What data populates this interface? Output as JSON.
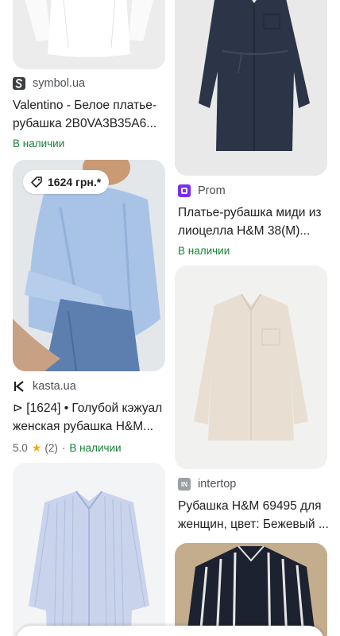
{
  "results": {
    "left": [
      {
        "source": "symbol.ua",
        "title": "Valentino - Белое платье-рубашка 2B0VA3B35A6...",
        "stock": "В наличии"
      },
      {
        "price": "1624 грн.*",
        "source": "kasta.ua",
        "title": "⊳ [1624] • Голубой кэжуал женская рубашка H&M...",
        "rating": "5.0",
        "reviews": "(2)",
        "separator": "·",
        "stock": "В наличии"
      }
    ],
    "right": [
      {
        "source": "Prom",
        "title": "Платье-рубашка миди из лиоцелла H&M 38(M)...",
        "stock": "В наличии"
      },
      {
        "source": "intertop",
        "source_icon_text": "IN",
        "title": "Рубашка H&M 69495 для женщин, цвет: Бежевый ..."
      }
    ]
  },
  "colors": {
    "in_stock": "#188038",
    "star": "#f9ab00",
    "prom_icon": "#7b2cf5"
  }
}
